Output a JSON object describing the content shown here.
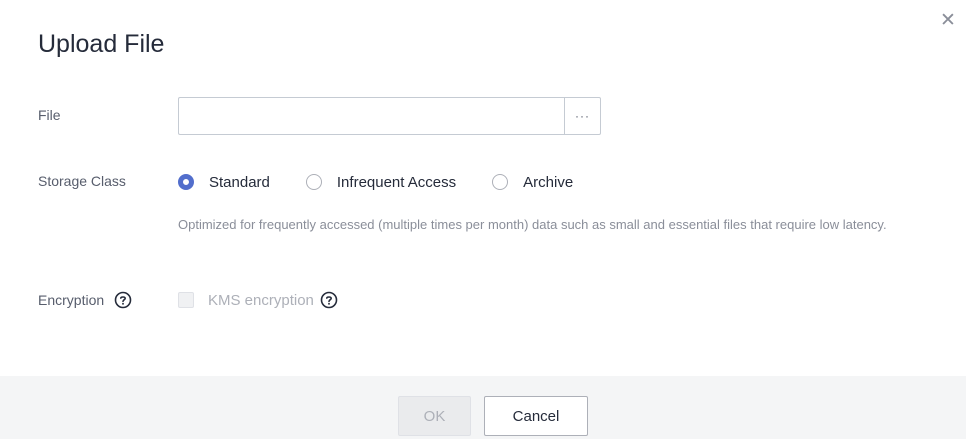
{
  "dialog": {
    "title": "Upload File",
    "close_icon": "close-icon"
  },
  "form": {
    "file": {
      "label": "File",
      "value": "",
      "placeholder": "",
      "browse_label": "···",
      "browse_icon": "ellipsis-icon"
    },
    "storage_class": {
      "label": "Storage Class",
      "options": [
        {
          "label": "Standard",
          "checked": true
        },
        {
          "label": "Infrequent Access",
          "checked": false
        },
        {
          "label": "Archive",
          "checked": false
        }
      ],
      "description": "Optimized for frequently accessed (multiple times per month) data such as small and essential files that require low latency."
    },
    "encryption": {
      "label": "Encryption",
      "label_icon": "help-icon",
      "checkbox_label": "KMS encryption",
      "checkbox_checked": false,
      "checkbox_disabled": true,
      "checkbox_icon": "help-icon"
    }
  },
  "footer": {
    "ok_label": "OK",
    "ok_disabled": true,
    "cancel_label": "Cancel"
  },
  "colors": {
    "accent": "#526ecc",
    "text_primary": "#252b3a",
    "text_secondary": "#575d6c",
    "text_muted": "#8a8e99",
    "text_disabled": "#adb0b8",
    "footer_bg": "#f4f5f6"
  }
}
